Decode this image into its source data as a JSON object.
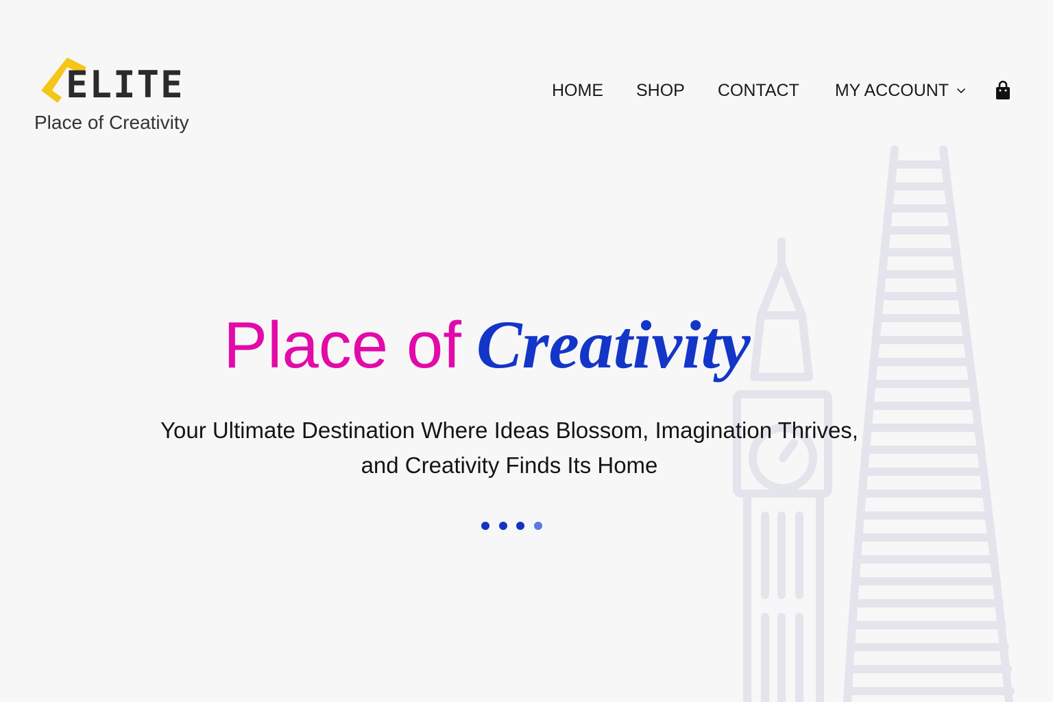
{
  "brand": {
    "logo_text": "ELITE",
    "tagline": "Place of Creativity",
    "logo_accent_color": "#f5c518",
    "logo_icon": "logo-chevron-icon"
  },
  "nav": {
    "items": [
      {
        "label": "HOME"
      },
      {
        "label": "SHOP"
      },
      {
        "label": "CONTACT"
      },
      {
        "label": "MY ACCOUNT",
        "icon": "chevron-down-icon"
      }
    ],
    "cart_icon": "shopping-bag-icon"
  },
  "hero": {
    "title_plain": "Place of",
    "title_accent": "Creativity",
    "title_plain_color": "#e20aa8",
    "title_accent_color": "#1336c8",
    "subtitle_line1": "Your Ultimate Destination Where Ideas Blossom, Imagination Thrives,",
    "subtitle_line2": "and Creativity Finds Its Home"
  },
  "slider": {
    "total_slides": 4,
    "active_slide": 4,
    "dot_color": "#1334c2",
    "active_dot_color": "#5a78e6"
  },
  "background": {
    "illustration": "city-landmarks-line-art",
    "line_color": "#e4e4ec"
  }
}
